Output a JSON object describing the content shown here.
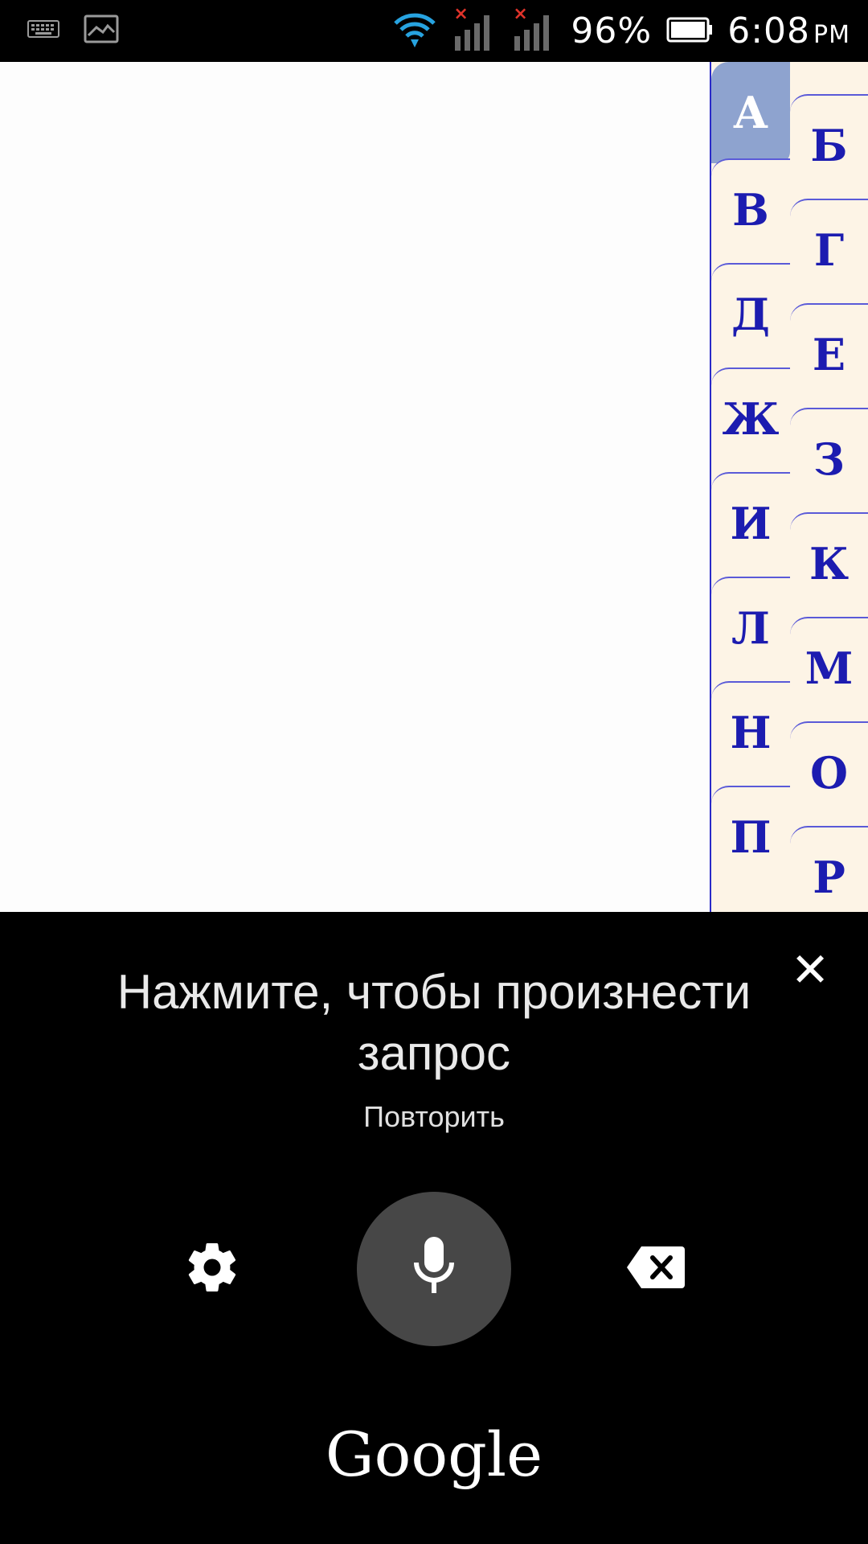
{
  "status_bar": {
    "battery_percent": "96%",
    "time": "6:08",
    "time_suffix": "PM",
    "icons": [
      "keyboard-icon",
      "image-icon",
      "wifi-icon",
      "signal-icon",
      "signal-icon",
      "battery-icon"
    ]
  },
  "alphabet_tabs": {
    "left_column": [
      "А",
      "В",
      "Д",
      "Ж",
      "И",
      "Л",
      "Н",
      "П"
    ],
    "right_column": [
      "Б",
      "Г",
      "Е",
      "З",
      "К",
      "М",
      "О",
      "Р"
    ],
    "active": "А"
  },
  "voice_panel": {
    "prompt": "Нажмите, чтобы произнести запрос",
    "retry_label": "Повторить",
    "brand": "Google",
    "icons": [
      "close-icon",
      "gear-icon",
      "microphone-icon",
      "backspace-icon"
    ]
  }
}
